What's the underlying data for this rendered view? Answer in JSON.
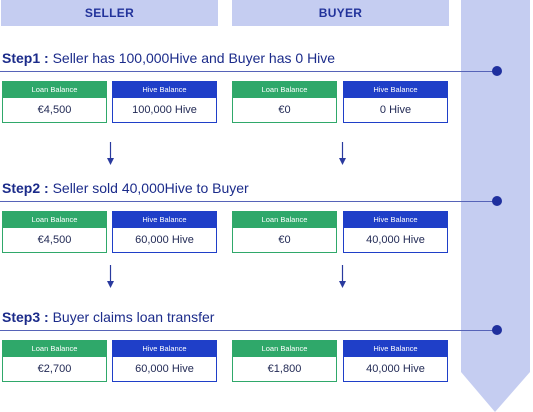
{
  "headers": {
    "seller": "SELLER",
    "buyer": "BUYER"
  },
  "steps": [
    {
      "label": "Step1 :",
      "text": "Seller has 100,000Hive and Buyer has 0 Hive",
      "cards": [
        {
          "type": "loan",
          "label": "Loan Balance",
          "value": "€4,500"
        },
        {
          "type": "hive",
          "label": "Hive Balance",
          "value": "100,000 Hive"
        },
        {
          "type": "loan",
          "label": "Loan Balance",
          "value": "€0"
        },
        {
          "type": "hive",
          "label": "Hive Balance",
          "value": "0 Hive"
        }
      ]
    },
    {
      "label": "Step2 :",
      "text": "Seller sold 40,000Hive to Buyer",
      "cards": [
        {
          "type": "loan",
          "label": "Loan Balance",
          "value": "€4,500"
        },
        {
          "type": "hive",
          "label": "Hive Balance",
          "value": "60,000 Hive"
        },
        {
          "type": "loan",
          "label": "Loan Balance",
          "value": "€0"
        },
        {
          "type": "hive",
          "label": "Hive Balance",
          "value": "40,000 Hive"
        }
      ]
    },
    {
      "label": "Step3 :",
      "text": "Buyer claims loan transfer",
      "cards": [
        {
          "type": "loan",
          "label": "Loan Balance",
          "value": "€2,700"
        },
        {
          "type": "hive",
          "label": "Hive Balance",
          "value": "60,000 Hive"
        },
        {
          "type": "loan",
          "label": "Loan Balance",
          "value": "€1,800"
        },
        {
          "type": "hive",
          "label": "Hive Balance",
          "value": "40,000 Hive"
        }
      ]
    }
  ],
  "colors": {
    "loan": "#2fa86a",
    "hive": "#1f3fc8",
    "timeline": "#c5cdf1",
    "accent": "#1f2f9e"
  }
}
